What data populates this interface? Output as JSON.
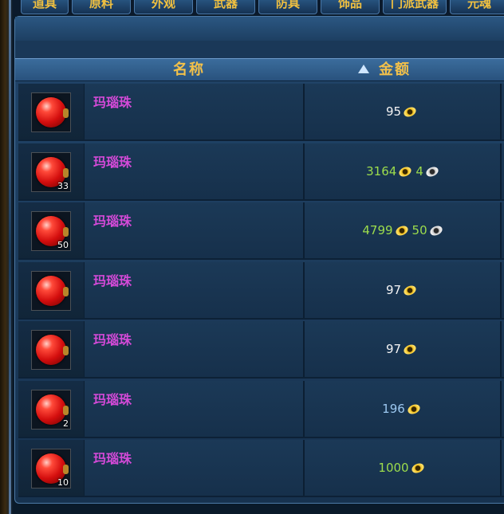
{
  "tabs": [
    "道具",
    "原料",
    "外观",
    "武器",
    "防具",
    "饰品",
    "门派武器",
    "元魂"
  ],
  "header": {
    "name_label": "名称",
    "price_label": "金额"
  },
  "colors": {
    "white": "#f4f4f4",
    "green": "#9cdc4c",
    "blue": "#9cc8f0",
    "name": "#d44ad8",
    "header": "#f3c14a"
  },
  "items": [
    {
      "name": "玛瑙珠",
      "qty": "",
      "gold": "95",
      "silver": "",
      "color": "white",
      "icon": "red-gem-icon"
    },
    {
      "name": "玛瑙珠",
      "qty": "33",
      "gold": "3164",
      "silver": "4",
      "color": "green",
      "icon": "red-gem-icon"
    },
    {
      "name": "玛瑙珠",
      "qty": "50",
      "gold": "4799",
      "silver": "50",
      "color": "green",
      "icon": "red-gem-icon"
    },
    {
      "name": "玛瑙珠",
      "qty": "",
      "gold": "97",
      "silver": "",
      "color": "white",
      "icon": "red-gem-icon"
    },
    {
      "name": "玛瑙珠",
      "qty": "",
      "gold": "97",
      "silver": "",
      "color": "white",
      "icon": "red-gem-icon"
    },
    {
      "name": "玛瑙珠",
      "qty": "2",
      "gold": "196",
      "silver": "",
      "color": "blue",
      "icon": "red-gem-icon"
    },
    {
      "name": "玛瑙珠",
      "qty": "10",
      "gold": "1000",
      "silver": "",
      "color": "green",
      "icon": "red-gem-icon"
    }
  ]
}
